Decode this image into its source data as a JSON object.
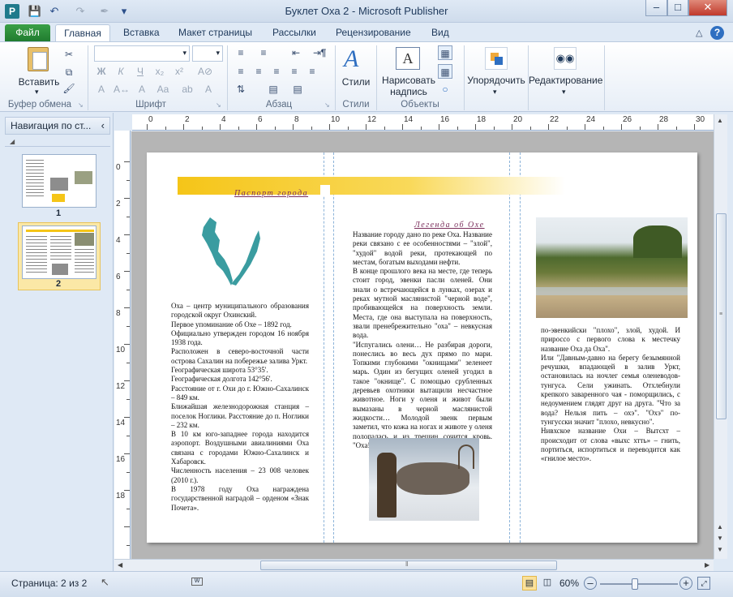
{
  "window": {
    "title": "Буклет Оха 2 - Microsoft Publisher",
    "app_icon": "publisher-icon"
  },
  "tabs": [
    "Файл",
    "Главная",
    "Вставка",
    "Макет страницы",
    "Рассылки",
    "Рецензирование",
    "Вид"
  ],
  "ribbon": {
    "paste_label": "Вставить",
    "groups": {
      "clipboard": "Буфер обмена",
      "font": "Шрифт",
      "paragraph": "Абзац",
      "styles": "Стили",
      "objects": "Объекты"
    },
    "styles_label": "Стили",
    "textbox_label1": "Нарисовать",
    "textbox_label2": "надпись",
    "arrange_label": "Упорядочить",
    "editing_label": "Редактирование"
  },
  "nav": {
    "title": "Навигация по ст...",
    "pages": [
      {
        "num": "1"
      },
      {
        "num": "2",
        "selected": true
      }
    ]
  },
  "ruler": {
    "h_labels": [
      "0",
      "2",
      "4",
      "6",
      "8",
      "10",
      "12",
      "14",
      "16",
      "18",
      "20",
      "22",
      "24",
      "26",
      "28",
      "30"
    ],
    "v_labels": [
      "0",
      "2",
      "4",
      "6",
      "8",
      "10",
      "12",
      "14",
      "16",
      "18"
    ]
  },
  "page": {
    "col1_heading": "Паспорт города",
    "col1_text": "Оха – центр муниципального образования городской округ Охинский.\nПервое упоминание об Охе – 1892 год.\nОфициально утвержден городом 16 ноября 1938 года.\nРасположен в северо-восточной части острова Сахалин на побережье залива Уркт.\nГеографическая широта 53°35'.\nГеографическая долгота 142°56'.\nРасстояние от г. Охи до г. Южно-Сахалинск – 849 км.\nБлижайшая железнодорожная станция – поселок Ноглики. Расстояние до п. Ноглики – 232 км.\nВ 10 км юго-западнее города находится аэропорт. Воздушными авиалиниями Оха связана с городами Южно-Сахалинск и Хабаровск.\nЧисленность населения – 23 008 человек (2010 г.).\nВ 1978 году Оха награждена государственной наградой – орденом «Знак Почета».",
    "col2_heading": "Легенда об Охе",
    "col2_text": "Название городу дано по реке Оха. Название реки связано с ее особенностями – \"злой\", \"худой\" водой реки, протекающей по местам, богатым выходами нефти.\nВ конце прошлого века на месте, где теперь стоит город, эвенки пасли оленей. Они знали о встречающейся в лунках, озерах и реках мутной маслянистой \"черной воде\", пробивающейся на поверхность земли. Места, где она выступала на поверхность, звали пренебрежительно \"оха\" – невкусная вода.\n\"Испугались олени… Не разбирая дороги, понеслись во весь дух прямо по мари. Топкими глубокими \"окнищами\" зеленеет марь. Один из бегущих оленей угодил в такое \"окнище\". С помощью срубленных деревьев охотники вытащили несчастное животное. Ноги у оленя и живот были вымазаны в черной маслянистой жидкости… Молодой эвенк первым заметил, что кожа на ногах и животе у оленя полопалась и из трещин сочится кровь. \"Оха!\" – воскликнул эвенк. \"Оха\" –",
    "col3_text": "по-эвенкийски \"плохо\", злой, худой. И прироссо с первого слова к местечку название Оха да Оха\".\nИли \"Давным-давно на берегу безымянной речушки, впадающей в залив Уркт, остановилась на ночлег семья оленеводов-тунгуса. Сели ужинать. Отхлебнули крепкого заваренного чая - поморщились, с недоумением глядят друг на друга. \"Что за вода? Нельзя пить – охэ\". \"Охэ\" по-тунгусски значит \"плохо, невкусно\".\nНивхское название Охи – Вытсхт – происходит от слова «выхс хтть» – гнить, портиться, испортиться и переводится как «гнилое место»."
  },
  "status": {
    "page_label": "Страница: 2 из 2",
    "zoom": "60%",
    "zoom_fraction": 0.45
  },
  "colors": {
    "file_tab": "#2a8a3a",
    "accent_band": "#f5c518",
    "heading": "#7b2f5c"
  }
}
